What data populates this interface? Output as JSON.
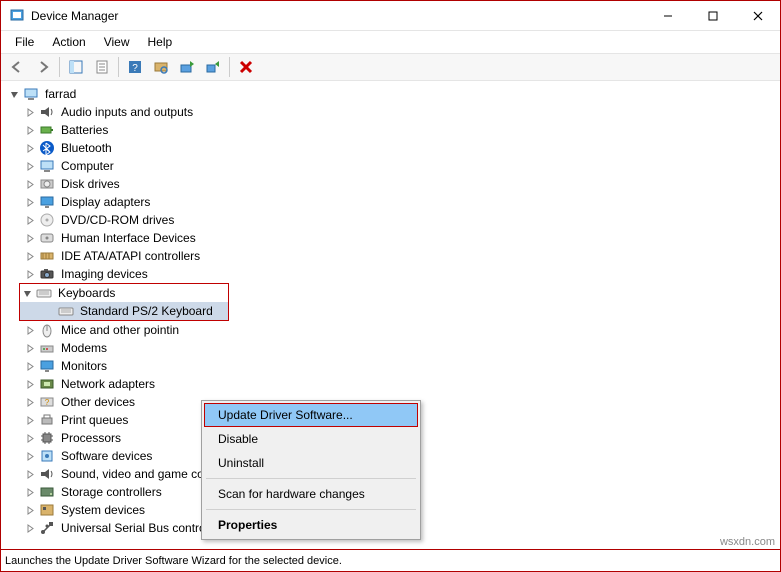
{
  "window": {
    "title": "Device Manager"
  },
  "menubar": {
    "file": "File",
    "action": "Action",
    "view": "View",
    "help": "Help"
  },
  "tree": {
    "root": "farrad",
    "items": [
      {
        "label": "Audio inputs and outputs",
        "icon": "audio"
      },
      {
        "label": "Batteries",
        "icon": "battery"
      },
      {
        "label": "Bluetooth",
        "icon": "bluetooth"
      },
      {
        "label": "Computer",
        "icon": "computer"
      },
      {
        "label": "Disk drives",
        "icon": "disk"
      },
      {
        "label": "Display adapters",
        "icon": "display"
      },
      {
        "label": "DVD/CD-ROM drives",
        "icon": "dvd"
      },
      {
        "label": "Human Interface Devices",
        "icon": "hid"
      },
      {
        "label": "IDE ATA/ATAPI controllers",
        "icon": "ide"
      },
      {
        "label": "Imaging devices",
        "icon": "imaging"
      },
      {
        "label": "Keyboards",
        "icon": "keyboard",
        "expanded": true,
        "highlighted": true,
        "children": [
          {
            "label": "Standard PS/2 Keyboard",
            "icon": "keyboard",
            "selected": true
          }
        ]
      },
      {
        "label": "Mice and other pointin",
        "icon": "mouse"
      },
      {
        "label": "Modems",
        "icon": "modem"
      },
      {
        "label": "Monitors",
        "icon": "monitor"
      },
      {
        "label": "Network adapters",
        "icon": "network"
      },
      {
        "label": "Other devices",
        "icon": "other"
      },
      {
        "label": "Print queues",
        "icon": "printer"
      },
      {
        "label": "Processors",
        "icon": "cpu"
      },
      {
        "label": "Software devices",
        "icon": "software"
      },
      {
        "label": "Sound, video and game controllers",
        "icon": "sound"
      },
      {
        "label": "Storage controllers",
        "icon": "storage"
      },
      {
        "label": "System devices",
        "icon": "system"
      },
      {
        "label": "Universal Serial Bus controllers",
        "icon": "usb"
      }
    ]
  },
  "context_menu": {
    "update": "Update Driver Software...",
    "disable": "Disable",
    "uninstall": "Uninstall",
    "scan": "Scan for hardware changes",
    "properties": "Properties"
  },
  "statusbar": {
    "text": "Launches the Update Driver Software Wizard for the selected device."
  },
  "watermark": "wsxdn.com"
}
